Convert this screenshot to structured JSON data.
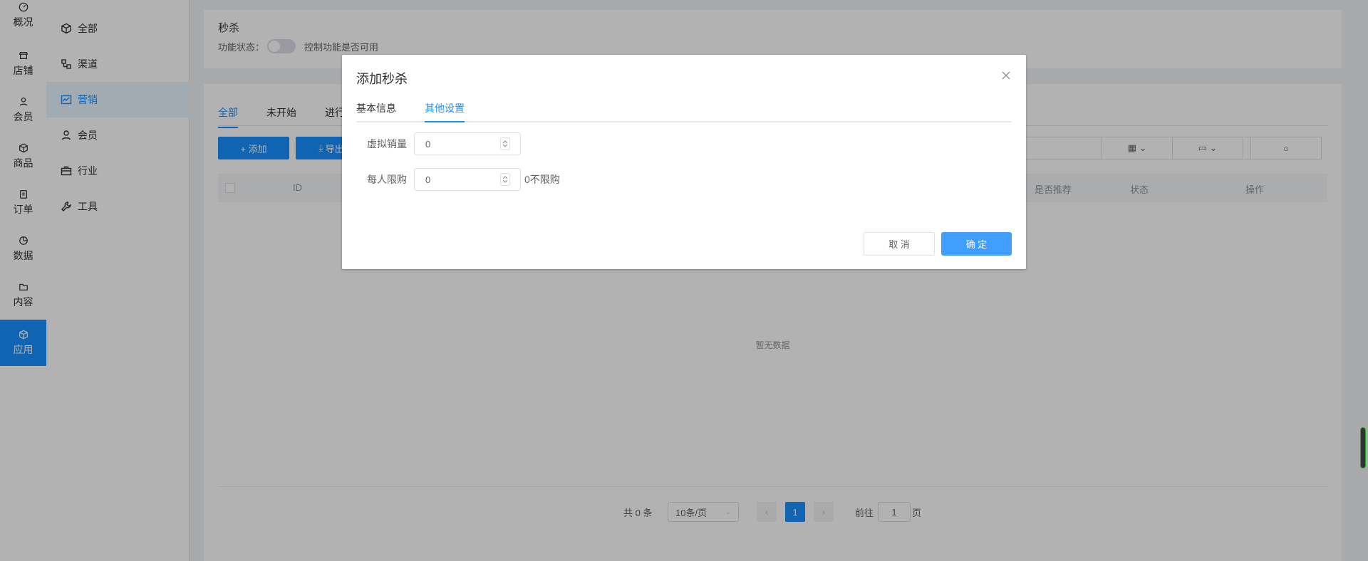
{
  "rail": [
    {
      "label": "概况",
      "icon": "dashboard-icon"
    },
    {
      "label": "店铺",
      "icon": "store-icon"
    },
    {
      "label": "会员",
      "icon": "user-icon"
    },
    {
      "label": "商品",
      "icon": "box-icon"
    },
    {
      "label": "订单",
      "icon": "clipboard-icon"
    },
    {
      "label": "数据",
      "icon": "pie-icon"
    },
    {
      "label": "内容",
      "icon": "folder-icon"
    },
    {
      "label": "应用",
      "icon": "cube-icon",
      "active": true
    }
  ],
  "subnav": [
    {
      "label": "全部",
      "icon": "cube-icon"
    },
    {
      "label": "渠道",
      "icon": "channel-icon"
    },
    {
      "label": "营销",
      "icon": "chart-icon",
      "active": true
    },
    {
      "label": "会员",
      "icon": "user-icon"
    },
    {
      "label": "行业",
      "icon": "briefcase-icon"
    },
    {
      "label": "工具",
      "icon": "wrench-icon"
    }
  ],
  "page": {
    "title": "秒杀",
    "status_label": "功能状态：",
    "status_hint": "控制功能是否可用"
  },
  "tabs": [
    "全部",
    "未开始",
    "进行"
  ],
  "toolbar": {
    "add": "+ 添加",
    "export": "导出"
  },
  "table": {
    "columns": [
      "ID",
      "是否推荐",
      "状态",
      "操作"
    ],
    "empty": "暂无数据"
  },
  "pager": {
    "total": "共 0 条",
    "size": "10条/页",
    "page": "1",
    "goto_label": "前往",
    "goto_value": "1",
    "page_suffix": "页"
  },
  "modal": {
    "title": "添加秒杀",
    "tabs": [
      "基本信息",
      "其他设置"
    ],
    "active_tab": 1,
    "fields": [
      {
        "label": "虚拟销量",
        "value": "0",
        "tip": ""
      },
      {
        "label": "每人限购",
        "value": "0",
        "tip": "0不限购"
      }
    ],
    "cancel": "取 消",
    "ok": "确 定"
  },
  "colors": {
    "primary": "#1890ff",
    "ok_button": "#409eff"
  }
}
